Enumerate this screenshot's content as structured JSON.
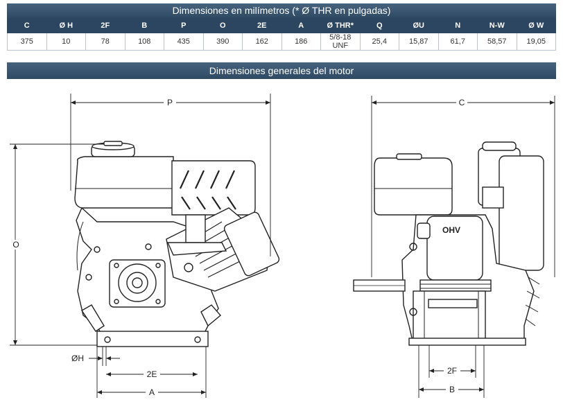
{
  "table": {
    "title": "Dimensiones en milímetros (* Ø THR en pulgadas)",
    "headers": [
      "C",
      "Ø H",
      "2F",
      "B",
      "P",
      "O",
      "2E",
      "A",
      "Ø THR*",
      "Q",
      "ØU",
      "N",
      "N-W",
      "Ø W"
    ],
    "values": [
      "375",
      "10",
      "78",
      "108",
      "435",
      "390",
      "162",
      "186",
      "5/8-18 UNF",
      "25,4",
      "15,87",
      "61,7",
      "58,57",
      "19,05"
    ]
  },
  "drawing": {
    "title": "Dimensiones generales del motor",
    "labels": {
      "P": "P",
      "O": "O",
      "H": "ØH",
      "E2": "2E",
      "A": "A",
      "C": "C",
      "F2": "2F",
      "B": "B",
      "ohv": "OHV"
    }
  }
}
